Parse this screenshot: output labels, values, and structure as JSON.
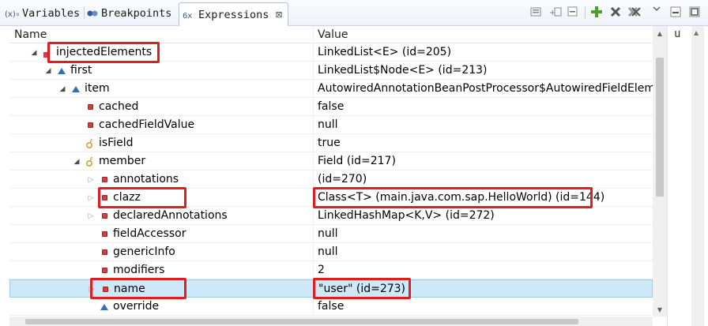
{
  "tabs": [
    {
      "label": "Variables",
      "icon": "variables-icon",
      "active": false
    },
    {
      "label": "Breakpoints",
      "icon": "breakpoints-icon",
      "active": false
    },
    {
      "label": "Expressions",
      "icon": "expressions-icon",
      "active": true,
      "close": "⊠"
    }
  ],
  "toolbar": [
    "collapse-all-icon",
    "select-expressions-icon",
    "show-logical-icon",
    "add-expression-icon",
    "remove-expression-icon",
    "remove-all-icon",
    "view-menu-icon",
    "minimize-icon",
    "maximize-icon"
  ],
  "columns": {
    "name": "Name",
    "value": "Value"
  },
  "rows": [
    {
      "name": "injectedElements",
      "value": "LinkedList<E>  (id=205)",
      "level": 0,
      "twisty": "expanded",
      "icon": "field-icon",
      "highlight": true
    },
    {
      "name": "first",
      "value": "LinkedList$Node<E>  (id=213)",
      "level": 1,
      "twisty": "expanded",
      "icon": "package-field-icon"
    },
    {
      "name": "item",
      "value": "AutowiredAnnotationBeanPostProcessor$AutowiredFieldElement",
      "level": 2,
      "twisty": "expanded",
      "icon": "package-field-icon"
    },
    {
      "name": "cached",
      "value": "false",
      "level": 3,
      "twisty": "none",
      "icon": "private-field-icon"
    },
    {
      "name": "cachedFieldValue",
      "value": "null",
      "level": 3,
      "twisty": "none",
      "icon": "private-field-icon"
    },
    {
      "name": "isField",
      "value": "true",
      "level": 3,
      "twisty": "none",
      "icon": "final-field-icon"
    },
    {
      "name": "member",
      "value": "Field  (id=217)",
      "level": 3,
      "twisty": "expanded",
      "icon": "final-field-icon"
    },
    {
      "name": "annotations",
      "value": "(id=270)",
      "level": 4,
      "twisty": "collapsed",
      "icon": "private-field-icon"
    },
    {
      "name": "clazz",
      "value": "Class<T> (main.java.com.sap.HelloWorld) (id=144)",
      "level": 4,
      "twisty": "collapsed",
      "icon": "private-field-icon",
      "highlight": true
    },
    {
      "name": "declaredAnnotations",
      "value": "LinkedHashMap<K,V>  (id=272)",
      "level": 4,
      "twisty": "collapsed",
      "icon": "private-field-icon"
    },
    {
      "name": "fieldAccessor",
      "value": "null",
      "level": 4,
      "twisty": "none",
      "icon": "private-field-icon"
    },
    {
      "name": "genericInfo",
      "value": "null",
      "level": 4,
      "twisty": "none",
      "icon": "private-field-icon"
    },
    {
      "name": "modifiers",
      "value": "2",
      "level": 4,
      "twisty": "none",
      "icon": "private-field-icon"
    },
    {
      "name": "name",
      "value": "\"user\" (id=273)",
      "level": 4,
      "twisty": "collapsed",
      "icon": "private-field-icon",
      "highlight": true,
      "selected": true
    },
    {
      "name": "override",
      "value": "false",
      "level": 4,
      "twisty": "none",
      "icon": "package-field-icon"
    }
  ],
  "side_panel": {
    "fragment": "u"
  },
  "colors": {
    "highlight": "#e11d1d",
    "selection": "#cde8f9",
    "private": "#d83b3b",
    "package": "#2e6fbf",
    "final": "#e8a21a"
  }
}
